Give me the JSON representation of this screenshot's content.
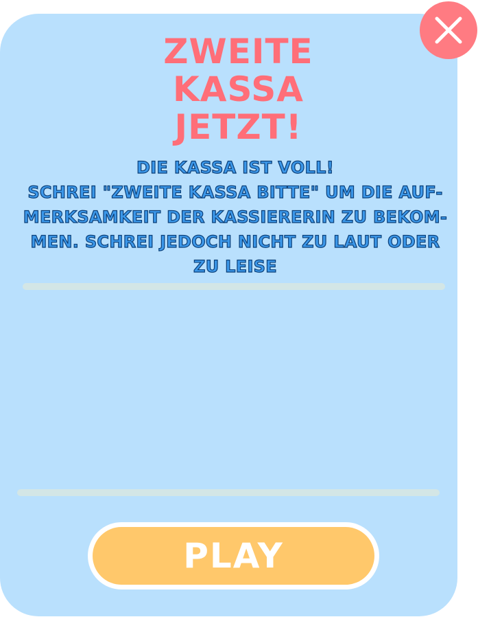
{
  "game": {
    "title_lines": [
      "ZWEITE",
      "KASSA",
      "JETZT!"
    ],
    "description_lines": [
      "DIE KASSA IST VOLL!",
      "SCHREI \"ZWEITE KASSA BITTE\" UM DIE AUF-",
      "MERKSAMKEIT DER KASSIERERIN ZU BEKOM-",
      "MEN. SCHREI JEDOCH NICHT ZU LAUT ODER",
      "ZU LEISE"
    ],
    "play_label": "PLAY",
    "close_icon": "close-icon"
  },
  "colors": {
    "panel_background": "#b9e0fd",
    "title": "#ff6e78",
    "description": "#3c98ea",
    "description_outline": "#0b3f78",
    "close_button": "#ff7b82",
    "play_button": "#ffc86b",
    "track": "#d3e6e6"
  }
}
